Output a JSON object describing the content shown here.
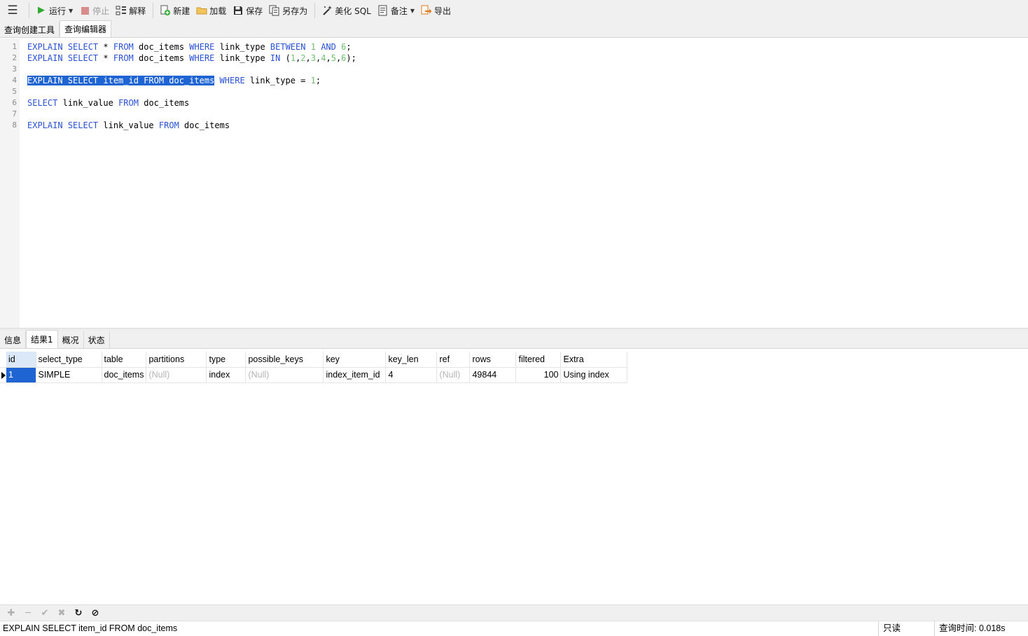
{
  "toolbar": {
    "menu_icon": "hamburger-icon",
    "run": "运行",
    "stop": "停止",
    "explain": "解释",
    "new": "新建",
    "load": "加载",
    "save": "保存",
    "save_as": "另存为",
    "beautify": "美化 SQL",
    "note": "备注",
    "export": "导出",
    "colors": {
      "run": "#2eaa2e",
      "stop": "#d98c8c",
      "export": "#e07a1a"
    }
  },
  "editor_tabs": [
    "查询创建工具",
    "查询编辑器"
  ],
  "editor": {
    "line_numbers": [
      "1",
      "2",
      "3",
      "4",
      "5",
      "6",
      "7",
      "8"
    ],
    "lines": {
      "l1": {
        "kw1": "EXPLAIN",
        "kw2": "SELECT",
        "star": "*",
        "kw3": "FROM",
        "tbl": "doc_items",
        "kw4": "WHERE",
        "col": "link_type",
        "kw5": "BETWEEN",
        "n1": "1",
        "kw6": "AND",
        "n2": "6",
        "end": ";"
      },
      "l2": {
        "kw1": "EXPLAIN",
        "kw2": "SELECT",
        "star": "*",
        "kw3": "FROM",
        "tbl": "doc_items",
        "kw4": "WHERE",
        "col": "link_type",
        "kw5": "IN",
        "open": "(",
        "n1": "1",
        "n2": "2",
        "n3": "3",
        "n4": "4",
        "n5": "5",
        "n6": "6",
        "comma": ",",
        "close": ");"
      },
      "l4": {
        "selected": "EXPLAIN SELECT item_id FROM doc_items",
        "kw1": "WHERE",
        "col": "link_type",
        "eq": "=",
        "n1": "1",
        "end": ";"
      },
      "l6": {
        "kw1": "SELECT",
        "col": "link_value",
        "kw2": "FROM",
        "tbl": "doc_items"
      },
      "l8": {
        "kw1": "EXPLAIN",
        "kw2": "SELECT",
        "col": "link_value",
        "kw3": "FROM",
        "tbl": "doc_items"
      }
    },
    "colors": {
      "keyword": "#2a52d6",
      "number": "#6fbf6f",
      "selection": "#1e64d2"
    }
  },
  "result_tabs": [
    "信息",
    "结果1",
    "概况",
    "状态"
  ],
  "grid": {
    "columns": [
      "id",
      "select_type",
      "table",
      "partitions",
      "type",
      "possible_keys",
      "key",
      "key_len",
      "ref",
      "rows",
      "filtered",
      "Extra"
    ],
    "rows": [
      [
        "1",
        "SIMPLE",
        "doc_items",
        "(Null)",
        "index",
        "(Null)",
        "index_item_id",
        "4",
        "(Null)",
        "49844",
        "100",
        "Using index"
      ]
    ]
  },
  "grid_toolbar": {
    "add_icon": "plus-icon",
    "remove_icon": "minus-icon",
    "apply_icon": "check-icon",
    "discard_icon": "x-icon",
    "refresh_icon": "refresh-icon",
    "stop_icon": "stop-icon"
  },
  "status": {
    "sql": "EXPLAIN SELECT item_id FROM doc_items",
    "mode": "只读",
    "time": "查询时间: 0.018s"
  }
}
